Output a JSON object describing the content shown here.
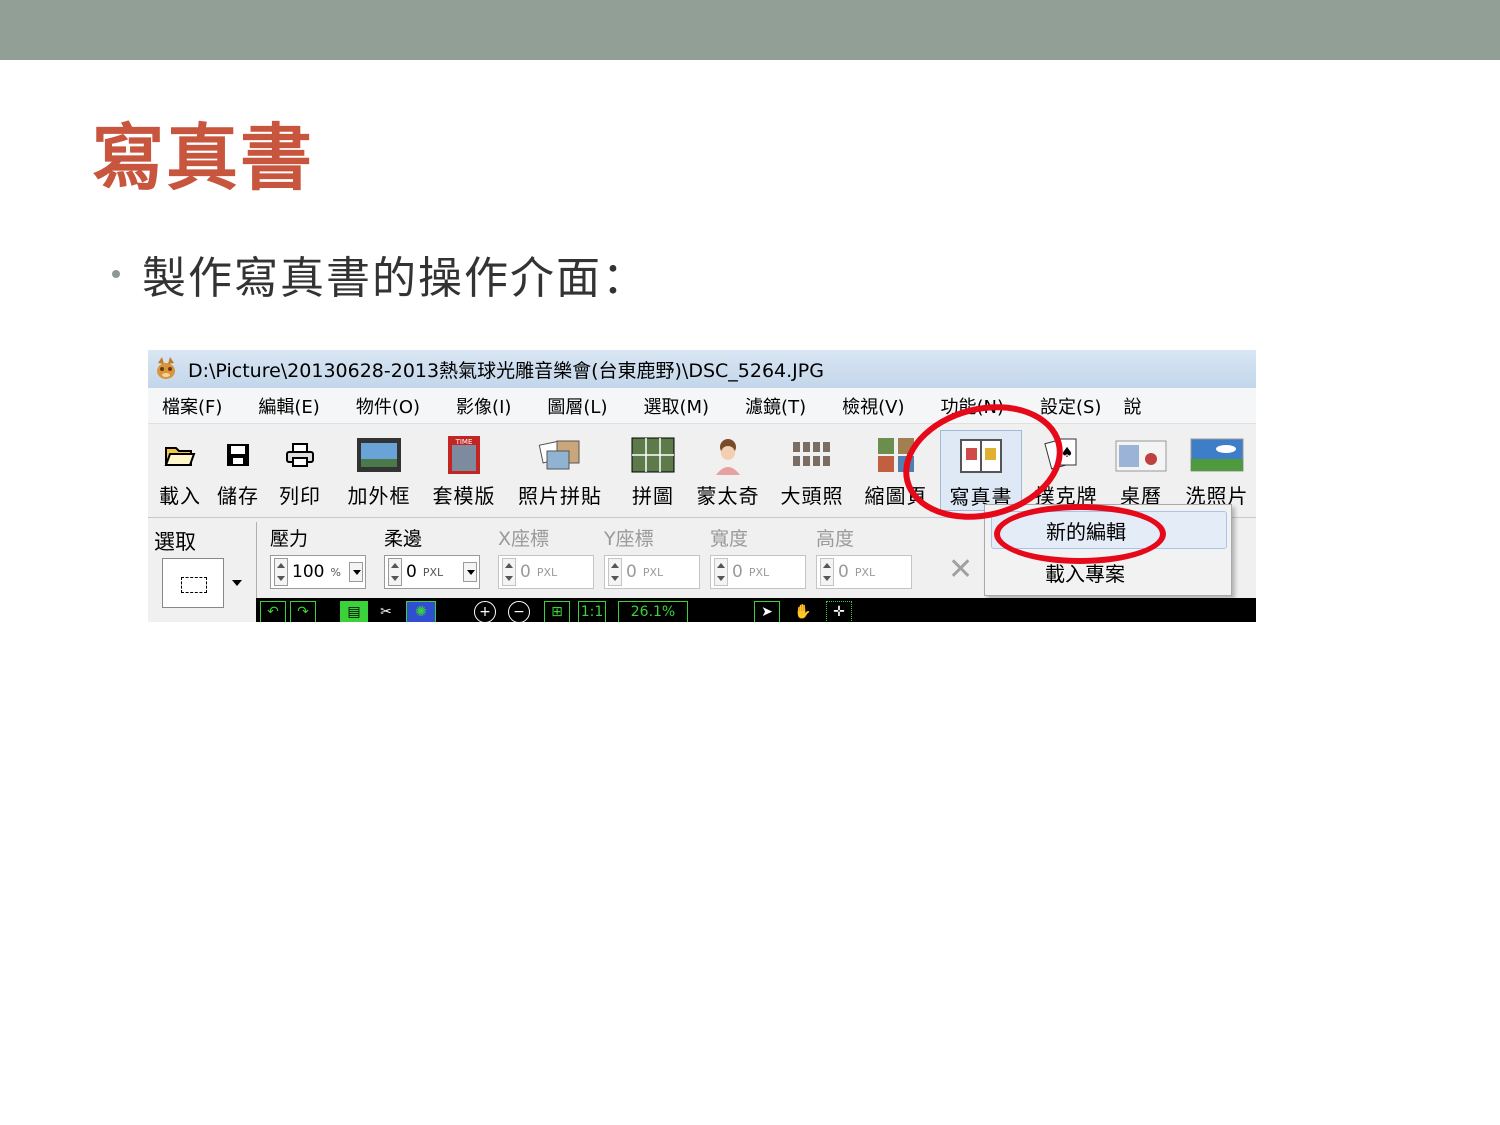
{
  "slide": {
    "title": "寫真書",
    "bullet": "製作寫真書的操作介面："
  },
  "window": {
    "title": "D:\\Picture\\20130628-2013熱氣球光雕音樂會(台東鹿野)\\DSC_5264.JPG"
  },
  "menu": [
    "檔案(F)",
    "編輯(E)",
    "物件(O)",
    "影像(I)",
    "圖層(L)",
    "選取(M)",
    "濾鏡(T)",
    "檢視(V)",
    "功能(N)",
    "設定(S)",
    "說"
  ],
  "toolbar": [
    {
      "label": "載入",
      "icon": "open-folder-icon"
    },
    {
      "label": "儲存",
      "icon": "save-disk-icon"
    },
    {
      "label": "列印",
      "icon": "printer-icon"
    },
    {
      "label": "加外框",
      "icon": "frame-icon"
    },
    {
      "label": "套模版",
      "icon": "template-icon"
    },
    {
      "label": "照片拼貼",
      "icon": "collage-icon"
    },
    {
      "label": "拼圖",
      "icon": "puzzle-icon"
    },
    {
      "label": "蒙太奇",
      "icon": "montage-icon"
    },
    {
      "label": "大頭照",
      "icon": "id-photo-icon"
    },
    {
      "label": "縮圖頁",
      "icon": "thumbnail-icon"
    },
    {
      "label": "寫真書",
      "icon": "photo-book-icon"
    },
    {
      "label": "撲克牌",
      "icon": "poker-card-icon"
    },
    {
      "label": "桌曆",
      "icon": "calendar-icon"
    },
    {
      "label": "洗照片",
      "icon": "print-photo-icon"
    }
  ],
  "options": {
    "select_label": "選取",
    "pressure": {
      "label": "壓力",
      "value": "100",
      "unit": "%"
    },
    "soften": {
      "label": "柔邊",
      "value": "0",
      "unit": "PXL"
    },
    "x": {
      "label": "X座標",
      "value": "0",
      "unit": "PXL"
    },
    "y": {
      "label": "Y座標",
      "value": "0",
      "unit": "PXL"
    },
    "width": {
      "label": "寬度",
      "value": "0",
      "unit": "PXL"
    },
    "height": {
      "label": "高度",
      "value": "0",
      "unit": "PXL"
    },
    "close": "✕"
  },
  "popup": {
    "new_album": "新的編輯",
    "load_project": "載入專案"
  },
  "statusbar": {
    "zoom": "26.1%",
    "ratio": "1:1"
  },
  "colors": {
    "title": "#c8553d",
    "band": "#929f97",
    "annotation": "#e5091a"
  }
}
